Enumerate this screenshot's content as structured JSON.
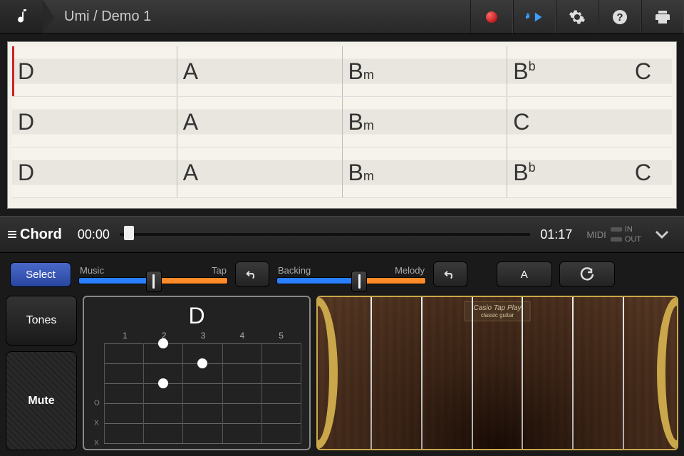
{
  "header": {
    "title": "Umi / Demo 1"
  },
  "chords": {
    "rows": [
      [
        {
          "root": "D"
        },
        {
          "root": "A"
        },
        {
          "root": "B",
          "suffix": "m"
        },
        {
          "root": "B",
          "accidental": "b",
          "second": "C"
        }
      ],
      [
        {
          "root": "D"
        },
        {
          "root": "A"
        },
        {
          "root": "B",
          "suffix": "m"
        },
        {
          "root": "C"
        }
      ],
      [
        {
          "root": "D"
        },
        {
          "root": "A"
        },
        {
          "root": "B",
          "suffix": "m"
        },
        {
          "root": "B",
          "accidental": "b",
          "second": "C"
        }
      ]
    ],
    "playhead": {
      "row": 0,
      "col": 0
    }
  },
  "transport": {
    "mode_label": "Chord",
    "time_current": "00:00",
    "time_total": "01:17",
    "midi_label": "MIDI",
    "midi_in": "IN",
    "midi_out": "OUT",
    "progress_pct": 1
  },
  "controls": {
    "select_label": "Select",
    "tones_label": "Tones",
    "mute_label": "Mute",
    "slider1": {
      "left": "Music",
      "right": "Tap",
      "pos": 45
    },
    "slider2": {
      "left": "Backing",
      "right": "Melody",
      "pos": 50
    },
    "key_label": "A"
  },
  "fretboard": {
    "chord": "D",
    "fret_numbers": [
      "1",
      "2",
      "3",
      "4",
      "5"
    ],
    "dots": [
      {
        "string": 2,
        "fret": 2
      },
      {
        "string": 0,
        "fret": 2
      },
      {
        "string": 1,
        "fret": 3
      }
    ],
    "open_markers": [
      {
        "string": 3,
        "sym": "O"
      },
      {
        "string": 4,
        "sym": "X"
      },
      {
        "string": 5,
        "sym": "X"
      }
    ]
  },
  "guitar": {
    "brand": "Casio Tap Play",
    "type": "classic guitar",
    "string_count": 6
  }
}
